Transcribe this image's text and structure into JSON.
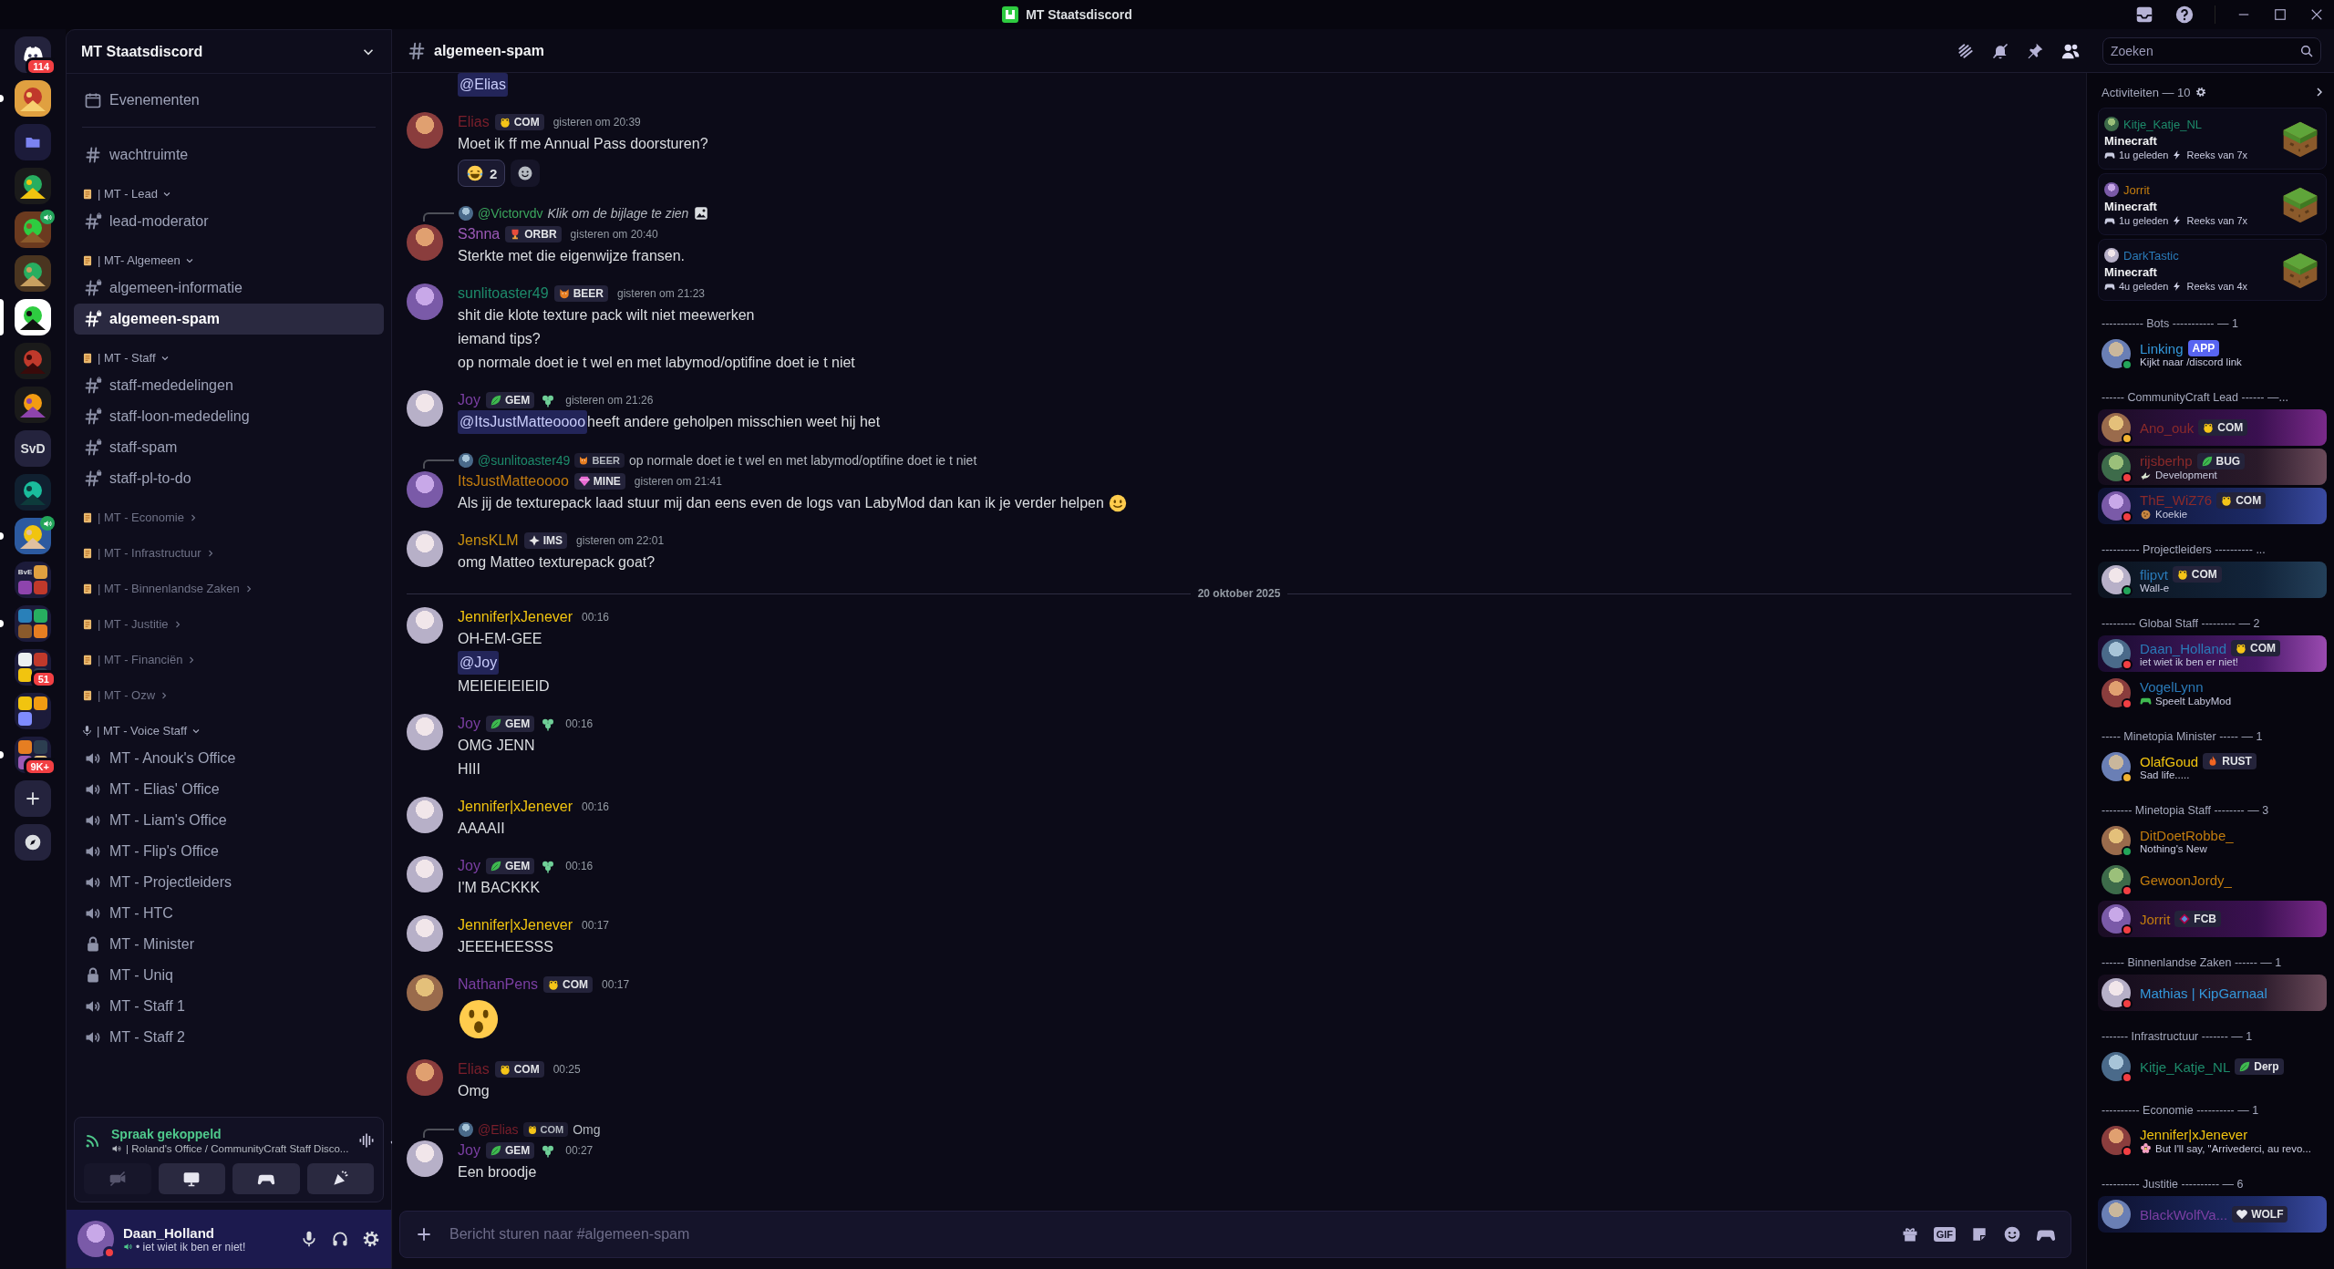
{
  "window": {
    "title": "MT Staatsdiscord"
  },
  "servers": [
    {
      "kind": "home",
      "badge": "114",
      "selected": false,
      "unread": false,
      "voice": false
    },
    {
      "kind": "picture",
      "selected": false,
      "unread": true,
      "voice": false
    },
    {
      "kind": "folder",
      "selected": false,
      "unread": false,
      "voice": false
    },
    {
      "kind": "picture",
      "selected": false,
      "unread": false,
      "voice": false
    },
    {
      "kind": "picture",
      "selected": false,
      "unread": false,
      "voice": true
    },
    {
      "kind": "picture",
      "selected": false,
      "unread": false,
      "voice": false
    },
    {
      "kind": "picture",
      "selected": true,
      "unread": false,
      "voice": false
    },
    {
      "kind": "picture",
      "selected": false,
      "unread": false,
      "voice": false
    },
    {
      "kind": "picture",
      "selected": false,
      "unread": false,
      "voice": false
    },
    {
      "kind": "text",
      "label": "SvD",
      "selected": false,
      "unread": false,
      "voice": false
    },
    {
      "kind": "picture",
      "selected": false,
      "unread": false,
      "voice": false
    },
    {
      "kind": "picture",
      "selected": false,
      "unread": true,
      "voice": true
    },
    {
      "kind": "grid",
      "label": "BvE",
      "selected": false,
      "unread": false,
      "voice": false
    },
    {
      "kind": "grid",
      "selected": false,
      "unread": true,
      "voice": false
    },
    {
      "kind": "grid",
      "badge": "51",
      "selected": false,
      "unread": false,
      "voice": false
    },
    {
      "kind": "grid",
      "selected": false,
      "unread": false,
      "voice": false
    },
    {
      "kind": "grid",
      "badge": "9K+",
      "selected": false,
      "unread": true,
      "voice": false
    },
    {
      "kind": "add",
      "selected": false,
      "unread": false,
      "voice": false
    },
    {
      "kind": "explore",
      "selected": false,
      "unread": false,
      "voice": false
    }
  ],
  "sidebar": {
    "title": "MT Staatsdiscord",
    "items": [
      {
        "kind": "event",
        "label": "Evenementen"
      },
      {
        "kind": "text",
        "label": "wachtruimte",
        "private": false,
        "selected": false
      },
      {
        "kind": "category",
        "label": "| MT - Lead",
        "expanded": true,
        "children": [
          {
            "kind": "text",
            "label": "lead-moderator",
            "private": true,
            "selected": false
          }
        ]
      },
      {
        "kind": "category",
        "label": "| MT- Algemeen",
        "expanded": true,
        "children": [
          {
            "kind": "text",
            "label": "algemeen-informatie",
            "private": true,
            "selected": false
          },
          {
            "kind": "text",
            "label": "algemeen-spam",
            "private": true,
            "selected": true
          }
        ]
      },
      {
        "kind": "category",
        "label": "| MT - Staff",
        "expanded": true,
        "children": [
          {
            "kind": "text",
            "label": "staff-mededelingen",
            "private": true,
            "selected": false
          },
          {
            "kind": "text",
            "label": "staff-loon-mededeling",
            "private": true,
            "selected": false
          },
          {
            "kind": "text",
            "label": "staff-spam",
            "private": true,
            "selected": false
          },
          {
            "kind": "text",
            "label": "staff-pl-to-do",
            "private": true,
            "selected": false
          }
        ]
      },
      {
        "kind": "category",
        "label": "| MT - Economie",
        "expanded": false
      },
      {
        "kind": "category",
        "label": "| MT - Infrastructuur",
        "expanded": false
      },
      {
        "kind": "category",
        "label": "| MT - Binnenlandse Zaken",
        "expanded": false
      },
      {
        "kind": "category",
        "label": "| MT - Justitie",
        "expanded": false
      },
      {
        "kind": "category",
        "label": "| MT - Financiën",
        "expanded": false
      },
      {
        "kind": "category",
        "label": "| MT - Ozw",
        "expanded": false
      },
      {
        "kind": "voice-category",
        "label": "| MT - Voice Staff",
        "expanded": true,
        "children": [
          {
            "kind": "voice",
            "label": "MT - Anouk's Office",
            "locked": false,
            "selected": false
          },
          {
            "kind": "voice",
            "label": "MT - Elias' Office",
            "locked": false,
            "selected": false
          },
          {
            "kind": "voice",
            "label": "MT - Liam's Office",
            "locked": false,
            "selected": false
          },
          {
            "kind": "voice",
            "label": "MT - Flip's Office",
            "locked": false,
            "selected": false
          },
          {
            "kind": "voice",
            "label": "MT - Projectleiders",
            "locked": false,
            "selected": false
          },
          {
            "kind": "voice",
            "label": "MT - HTC",
            "locked": false,
            "selected": false
          },
          {
            "kind": "voice",
            "label": "MT - Minister",
            "locked": true,
            "selected": false
          },
          {
            "kind": "voice",
            "label": "MT - Uniq",
            "locked": true,
            "selected": false
          },
          {
            "kind": "voice",
            "label": "MT - Staff 1",
            "locked": false,
            "selected": false
          },
          {
            "kind": "voice",
            "label": "MT - Staff 2",
            "locked": false,
            "selected": false
          }
        ]
      }
    ]
  },
  "voice_panel": {
    "status": "Spraak gekoppeld",
    "channel": "| Roland's Office / CommunityCraft Staff Disco...",
    "buttons": [
      {
        "kind": "camera",
        "disabled": true
      },
      {
        "kind": "screen",
        "disabled": false
      },
      {
        "kind": "activity",
        "disabled": false
      },
      {
        "kind": "soundboard",
        "disabled": false
      }
    ]
  },
  "user_panel": {
    "name": "Daan_Holland",
    "status": {
      "color": "#f23f43"
    },
    "custom_status": "• iet wiet ik ben er niet!"
  },
  "header": {
    "channel": "algemeen-spam",
    "search_placeholder": "Zoeken"
  },
  "chat": {
    "items": [
      {
        "kind": "continuation",
        "lines": [
          [
            {
              "kind": "mention",
              "text": "@Elias"
            }
          ]
        ]
      },
      {
        "kind": "message",
        "author": "Elias",
        "color": "#7a1f2b",
        "tag": {
          "kind": "frog",
          "label": "COM"
        },
        "extra_badge": false,
        "time": "gisteren om 20:39",
        "lines": [
          [
            {
              "kind": "text",
              "text": "Moet ik ff me Annual Pass doorsturen?"
            }
          ]
        ],
        "reactions": [
          {
            "kind": "laughing",
            "count": "2"
          }
        ]
      },
      {
        "kind": "message",
        "author": "S3nna",
        "color": "#9b59b6",
        "tag": {
          "kind": "trophy",
          "label": "ORBR"
        },
        "extra_badge": false,
        "time": "gisteren om 20:40",
        "reply": {
          "author": "@Victorvdv",
          "color": "#3ba55d",
          "text": "Klik om de bijlage te zien",
          "attachment": true
        },
        "lines": [
          [
            {
              "kind": "text",
              "text": "Sterkte met die eigenwijze fransen."
            }
          ]
        ]
      },
      {
        "kind": "message",
        "author": "sunlitoaster49",
        "color": "#1d8a6a",
        "tag": {
          "kind": "cat",
          "label": "BEER"
        },
        "extra_badge": false,
        "time": "gisteren om 21:23",
        "lines": [
          [
            {
              "kind": "text",
              "text": "shit die klote texture pack wilt niet meewerken"
            }
          ],
          [
            {
              "kind": "text",
              "text": "iemand tips?"
            }
          ],
          [
            {
              "kind": "text",
              "text": "op normale doet ie t wel en met labymod/optifine doet ie t niet"
            }
          ]
        ]
      },
      {
        "kind": "message",
        "author": "Joy",
        "color": "#7b3fa3",
        "tag": {
          "kind": "leaf",
          "label": "GEM"
        },
        "extra_badge": true,
        "time": "gisteren om 21:26",
        "lines": [
          [
            {
              "kind": "mention",
              "text": "@ItsJustMatteoooo"
            },
            {
              "kind": "text",
              "text": " heeft andere geholpen misschien weet hij het"
            }
          ]
        ]
      },
      {
        "kind": "message",
        "author": "ItsJustMatteoooo",
        "color": "#c27c0e",
        "tag": {
          "kind": "diamond",
          "label": "MINE"
        },
        "extra_badge": false,
        "time": "gisteren om 21:41",
        "reply": {
          "author": "@sunlitoaster49",
          "color": "#1d8a6a",
          "tag": {
            "kind": "cat",
            "label": "BEER"
          },
          "text": "op normale doet ie t wel en met labymod/optifine doet ie t niet",
          "attachment": false
        },
        "lines": [
          [
            {
              "kind": "text",
              "text": "Als jij de texturepack laad stuur mij dan eens even de logs van LabyMod dan kan ik je verder helpen "
            },
            {
              "kind": "smile"
            }
          ]
        ]
      },
      {
        "kind": "message",
        "author": "JensKLM",
        "color": "#c8900f",
        "tag": {
          "kind": "star",
          "label": "IMS"
        },
        "extra_badge": false,
        "time": "gisteren om 22:01",
        "lines": [
          [
            {
              "kind": "text",
              "text": "omg Matteo texturepack goat?"
            }
          ]
        ]
      },
      {
        "kind": "divider",
        "label": "20 oktober 2025"
      },
      {
        "kind": "message",
        "author": "Jennifer|xJenever",
        "color": "#f1c40f",
        "extra_badge": false,
        "time": "00:16",
        "lines": [
          [
            {
              "kind": "text",
              "text": "OH-EM-GEE"
            }
          ],
          [
            {
              "kind": "mention",
              "text": "@Joy"
            }
          ],
          [
            {
              "kind": "text",
              "text": "MEIEIEIEIEID"
            }
          ]
        ]
      },
      {
        "kind": "message",
        "author": "Joy",
        "color": "#7b3fa3",
        "tag": {
          "kind": "leaf",
          "label": "GEM"
        },
        "extra_badge": true,
        "time": "00:16",
        "lines": [
          [
            {
              "kind": "text",
              "text": "OMG JENN"
            }
          ],
          [
            {
              "kind": "text",
              "text": "HIII"
            }
          ]
        ]
      },
      {
        "kind": "message",
        "author": "Jennifer|xJenever",
        "color": "#f1c40f",
        "extra_badge": false,
        "time": "00:16",
        "lines": [
          [
            {
              "kind": "text",
              "text": "AAAAII"
            }
          ]
        ]
      },
      {
        "kind": "message",
        "author": "Joy",
        "color": "#7b3fa3",
        "tag": {
          "kind": "leaf",
          "label": "GEM"
        },
        "extra_badge": true,
        "time": "00:16",
        "lines": [
          [
            {
              "kind": "text",
              "text": "I'M BACKKK"
            }
          ]
        ]
      },
      {
        "kind": "message",
        "author": "Jennifer|xJenever",
        "color": "#f1c40f",
        "extra_badge": false,
        "time": "00:17",
        "lines": [
          [
            {
              "kind": "text",
              "text": "JEEEHEESSS"
            }
          ]
        ]
      },
      {
        "kind": "message",
        "author": "NathanPens",
        "color": "#7b3fa3",
        "tag": {
          "kind": "frog",
          "label": "COM"
        },
        "extra_badge": false,
        "time": "00:17",
        "lines": [
          [
            {
              "kind": "surprised"
            }
          ]
        ]
      },
      {
        "kind": "message",
        "author": "Elias",
        "color": "#7a1f2b",
        "tag": {
          "kind": "frog",
          "label": "COM"
        },
        "extra_badge": false,
        "time": "00:25",
        "lines": [
          [
            {
              "kind": "text",
              "text": "Omg"
            }
          ]
        ]
      },
      {
        "kind": "message",
        "author": "Joy",
        "color": "#7b3fa3",
        "tag": {
          "kind": "leaf",
          "label": "GEM"
        },
        "extra_badge": true,
        "time": "00:27",
        "reply": {
          "author": "@Elias",
          "color": "#7a1f2b",
          "tag": {
            "kind": "frog",
            "label": "COM"
          },
          "text": "Omg",
          "attachment": false
        },
        "lines": [
          [
            {
              "kind": "text",
              "text": "Een broodje"
            }
          ]
        ]
      }
    ]
  },
  "composer": {
    "placeholder": "Bericht sturen naar #algemeen-spam",
    "gif": "GIF"
  },
  "members": {
    "activities": {
      "title": "Activiteiten — 10",
      "items": [
        {
          "user": "Kitje_Katje_NL",
          "color": "#1d8a6a",
          "game": "Minecraft",
          "time": "1u geleden",
          "streak": "Reeks van 7x"
        },
        {
          "user": "Jorrit",
          "color": "#c27c0e",
          "game": "Minecraft",
          "time": "1u geleden",
          "streak": "Reeks van 7x"
        },
        {
          "user": "DarkTastic",
          "color": "#2a7ab8",
          "game": "Minecraft",
          "time": "4u geleden",
          "streak": "Reeks van 4x"
        }
      ]
    },
    "groups": [
      {
        "title": "----------- Bots ----------- — 1",
        "members": [
          {
            "name": "Linking",
            "color": "#3498db",
            "status": {
              "color": "#23a55a"
            },
            "banner": false,
            "tag": {
              "kind": "app",
              "label": "APP"
            },
            "activity": {
              "text": "Kijkt naar /discord link"
            }
          }
        ]
      },
      {
        "title": "------ CommunityCraft Lead ------ —...",
        "members": [
          {
            "name": "Ano_ouk",
            "color": "#8b2a2a",
            "status": {
              "color": "#f0b232"
            },
            "banner": true,
            "tag": {
              "kind": "frog",
              "label": "COM"
            }
          },
          {
            "name": "rijsberhp",
            "color": "#8b2a2a",
            "status": {
              "color": "#f23f43"
            },
            "banner": true,
            "tag": {
              "kind": "leaf",
              "label": "BUG"
            },
            "activity": {
              "kind": "bird",
              "text": "Development"
            }
          },
          {
            "name": "ThE_WiZ76",
            "color": "#8b2a2a",
            "status": {
              "color": "#f23f43"
            },
            "banner": true,
            "tag": {
              "kind": "frog",
              "label": "COM"
            },
            "activity": {
              "kind": "cookie",
              "text": "Koekie"
            }
          }
        ]
      },
      {
        "title": "---------- Projectleiders ---------- ...",
        "members": [
          {
            "name": "flipvt",
            "color": "#2a7ab8",
            "status": {
              "color": "#23a55a"
            },
            "banner": true,
            "tag": {
              "kind": "frog",
              "label": "COM"
            },
            "activity": {
              "text": "Wall-e"
            }
          }
        ]
      },
      {
        "title": "--------- Global Staff --------- — 2",
        "members": [
          {
            "name": "Daan_Holland",
            "color": "#2a7ab8",
            "status": {
              "color": "#f23f43"
            },
            "banner": true,
            "tag": {
              "kind": "frog",
              "label": "COM"
            },
            "activity": {
              "text": "iet wiet ik ben er niet!"
            }
          },
          {
            "name": "VogelLynn",
            "color": "#2a7ab8",
            "status": {
              "color": "#f23f43"
            },
            "banner": false,
            "activity": {
              "kind": "gamepad",
              "text": "Speelt LabyMod"
            }
          }
        ]
      },
      {
        "title": "----- Minetopia Minister ----- — 1",
        "members": [
          {
            "name": "OlafGoud",
            "color": "#f1c40f",
            "status": {
              "color": "#f0b232"
            },
            "banner": false,
            "tag": {
              "kind": "flame",
              "label": "RUST"
            },
            "activity": {
              "text": "Sad life....."
            }
          }
        ]
      },
      {
        "title": "-------- Minetopia Staff -------- — 3",
        "members": [
          {
            "name": "DitDoetRobbe_",
            "color": "#c27c0e",
            "status": {
              "color": "#23a55a"
            },
            "banner": false,
            "activity": {
              "text": "Nothing's New"
            }
          },
          {
            "name": "GewoonJordy_",
            "color": "#c27c0e",
            "status": {
              "color": "#f23f43"
            },
            "banner": false
          },
          {
            "name": "Jorrit",
            "color": "#c27c0e",
            "status": {
              "color": "#f23f43"
            },
            "banner": true,
            "tag": {
              "kind": "crest",
              "label": "FCB"
            }
          }
        ]
      },
      {
        "title": "------ Binnenlandse Zaken ------ — 1",
        "members": [
          {
            "name": "Mathias | KipGarnaal",
            "color": "#3498db",
            "status": {
              "color": "#f23f43"
            },
            "banner": true
          }
        ]
      },
      {
        "title": "------- Infrastructuur ------- — 1",
        "members": [
          {
            "name": "Kitje_Katje_NL",
            "color": "#1d8a6a",
            "status": {
              "color": "#f23f43"
            },
            "banner": false,
            "tag": {
              "kind": "leaf",
              "label": "Derp"
            }
          }
        ]
      },
      {
        "title": "---------- Economie ---------- — 1",
        "members": [
          {
            "name": "Jennifer|xJenever",
            "color": "#f1c40f",
            "status": {
              "color": "#f23f43"
            },
            "banner": false,
            "activity": {
              "kind": "flower",
              "text": "But I'll say, \"Arrivederci, au revo..."
            }
          }
        ]
      },
      {
        "title": "---------- Justitie ---------- — 6",
        "members": [
          {
            "name": "BlackWolfVa...",
            "color": "#7b3fa3",
            "banner": true,
            "tag": {
              "kind": "heart",
              "label": "WOLF"
            }
          }
        ]
      }
    ]
  }
}
